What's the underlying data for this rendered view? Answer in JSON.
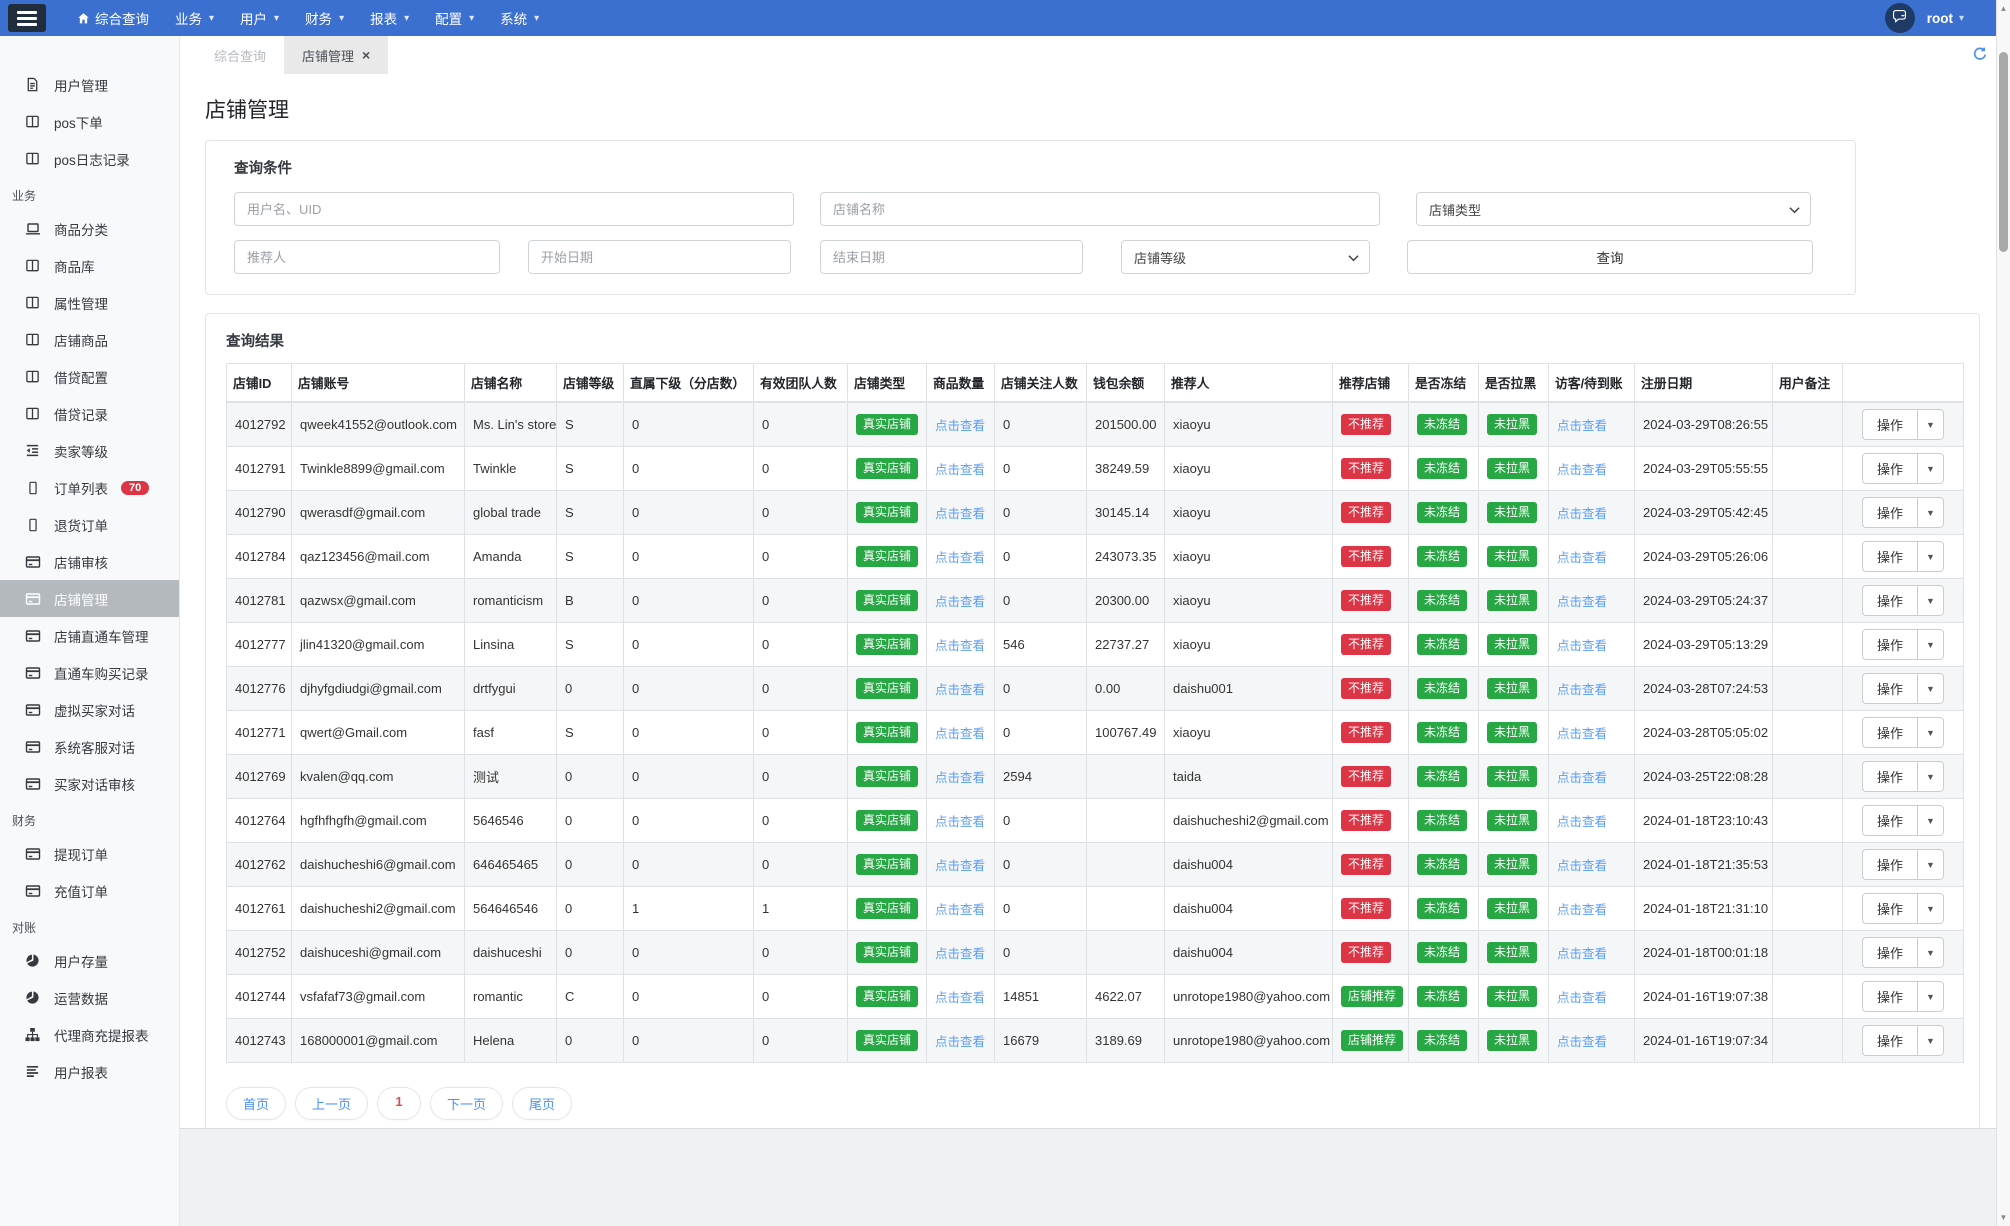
{
  "navbar": {
    "items": [
      {
        "key": "general-query",
        "label": "综合查询",
        "icon": "home",
        "caret": false
      },
      {
        "key": "business",
        "label": "业务",
        "caret": true
      },
      {
        "key": "user",
        "label": "用户",
        "caret": true
      },
      {
        "key": "finance",
        "label": "财务",
        "caret": true
      },
      {
        "key": "report",
        "label": "报表",
        "caret": true
      },
      {
        "key": "config",
        "label": "配置",
        "caret": true
      },
      {
        "key": "system",
        "label": "系统",
        "caret": true
      }
    ],
    "user": "root"
  },
  "sidebar": {
    "items": [
      {
        "key": "user-management",
        "label": "用户管理",
        "icon": "file"
      },
      {
        "key": "pos-order",
        "label": "pos下单",
        "icon": "table"
      },
      {
        "key": "pos-log",
        "label": "pos日志记录",
        "icon": "table"
      },
      {
        "section": "业务",
        "key": "section-business"
      },
      {
        "key": "goods-category",
        "label": "商品分类",
        "icon": "laptop"
      },
      {
        "key": "goods-library",
        "label": "商品库",
        "icon": "table"
      },
      {
        "key": "attribute-management",
        "label": "属性管理",
        "icon": "table"
      },
      {
        "key": "store-goods",
        "label": "店铺商品",
        "icon": "table"
      },
      {
        "key": "loan-config",
        "label": "借贷配置",
        "icon": "table"
      },
      {
        "key": "loan-record",
        "label": "借贷记录",
        "icon": "table"
      },
      {
        "key": "seller-level",
        "label": "卖家等级",
        "icon": "outdent"
      },
      {
        "key": "order-list",
        "label": "订单列表",
        "icon": "mobile",
        "badge": "70"
      },
      {
        "key": "return-order",
        "label": "退货订单",
        "icon": "mobile"
      },
      {
        "key": "store-audit",
        "label": "店铺审核",
        "icon": "card"
      },
      {
        "key": "store-management",
        "label": "店铺管理",
        "icon": "card",
        "active": true
      },
      {
        "key": "store-train-management",
        "label": "店铺直通车管理",
        "icon": "card"
      },
      {
        "key": "train-purchase-record",
        "label": "直通车购买记录",
        "icon": "card"
      },
      {
        "key": "virtual-buyer-chat",
        "label": "虚拟买家对话",
        "icon": "card"
      },
      {
        "key": "system-service-chat",
        "label": "系统客服对话",
        "icon": "card"
      },
      {
        "key": "buyer-chat-audit",
        "label": "买家对话审核",
        "icon": "card"
      },
      {
        "section": "财务",
        "key": "section-finance"
      },
      {
        "key": "withdraw-order",
        "label": "提现订单",
        "icon": "card"
      },
      {
        "key": "recharge-order",
        "label": "充值订单",
        "icon": "card"
      },
      {
        "section": "对账",
        "key": "section-reconciliation"
      },
      {
        "key": "user-stock",
        "label": "用户存量",
        "icon": "pie"
      },
      {
        "key": "operation-data",
        "label": "运营数据",
        "icon": "pie"
      },
      {
        "key": "agent-report",
        "label": "代理商充提报表",
        "icon": "sitemap"
      },
      {
        "key": "user-report",
        "label": "用户报表",
        "icon": "bars"
      }
    ]
  },
  "tabs": [
    {
      "key": "general-query",
      "label": "综合查询",
      "active": false,
      "closable": false
    },
    {
      "key": "store-management",
      "label": "店铺管理",
      "active": true,
      "closable": true
    }
  ],
  "page": {
    "title": "店铺管理"
  },
  "filter": {
    "title": "查询条件",
    "username_placeholder": "用户名、UID",
    "store_name_placeholder": "店铺名称",
    "store_type_placeholder": "店铺类型",
    "referrer_placeholder": "推荐人",
    "start_date_placeholder": "开始日期",
    "end_date_placeholder": "结束日期",
    "store_level_placeholder": "店铺等级",
    "submit_label": "查询"
  },
  "results": {
    "title": "查询结果",
    "columns": [
      "店铺ID",
      "店铺账号",
      "店铺名称",
      "店铺等级",
      "直属下级（分店数）",
      "有效团队人数",
      "店铺类型",
      "商品数量",
      "店铺关注人数",
      "钱包余额",
      "推荐人",
      "推荐店铺",
      "是否冻结",
      "是否拉黑",
      "访客/待到账",
      "注册日期",
      "用户备注",
      ""
    ],
    "store_type_label": "真实店铺",
    "view_link_label": "点击查看",
    "frozen_label": "未冻结",
    "blacklist_label": "未拉黑",
    "action_label": "操作",
    "rows": [
      {
        "id": "4012792",
        "account": "qweek41552@outlook.com",
        "name": "Ms. Lin's store",
        "level": "S",
        "direct_sub": "0",
        "team": "0",
        "followers": "0",
        "balance": "201500.00",
        "referrer": "xiaoyu",
        "recommend": "不推荐",
        "recommend_type": "danger",
        "registered": "2024-03-29T08:26:55",
        "remark": ""
      },
      {
        "id": "4012791",
        "account": "Twinkle8899@gmail.com",
        "name": "Twinkle",
        "level": "S",
        "direct_sub": "0",
        "team": "0",
        "followers": "0",
        "balance": "38249.59",
        "referrer": "xiaoyu",
        "recommend": "不推荐",
        "recommend_type": "danger",
        "registered": "2024-03-29T05:55:55",
        "remark": ""
      },
      {
        "id": "4012790",
        "account": "qwerasdf@gmail.com",
        "name": "global trade",
        "level": "S",
        "direct_sub": "0",
        "team": "0",
        "followers": "0",
        "balance": "30145.14",
        "referrer": "xiaoyu",
        "recommend": "不推荐",
        "recommend_type": "danger",
        "registered": "2024-03-29T05:42:45",
        "remark": ""
      },
      {
        "id": "4012784",
        "account": "qaz123456@mail.com",
        "name": "Amanda",
        "level": "S",
        "direct_sub": "0",
        "team": "0",
        "followers": "0",
        "balance": "243073.35",
        "referrer": "xiaoyu",
        "recommend": "不推荐",
        "recommend_type": "danger",
        "registered": "2024-03-29T05:26:06",
        "remark": ""
      },
      {
        "id": "4012781",
        "account": "qazwsx@gmail.com",
        "name": "romanticism",
        "level": "B",
        "direct_sub": "0",
        "team": "0",
        "followers": "0",
        "balance": "20300.00",
        "referrer": "xiaoyu",
        "recommend": "不推荐",
        "recommend_type": "danger",
        "registered": "2024-03-29T05:24:37",
        "remark": ""
      },
      {
        "id": "4012777",
        "account": "jlin41320@gmail.com",
        "name": "Linsina",
        "level": "S",
        "direct_sub": "0",
        "team": "0",
        "followers": "546",
        "balance": "22737.27",
        "referrer": "xiaoyu",
        "recommend": "不推荐",
        "recommend_type": "danger",
        "registered": "2024-03-29T05:13:29",
        "remark": ""
      },
      {
        "id": "4012776",
        "account": "djhyfgdiudgi@gmail.com",
        "name": "drtfygui",
        "level": "0",
        "direct_sub": "0",
        "team": "0",
        "followers": "0",
        "balance": "0.00",
        "referrer": "daishu001",
        "recommend": "不推荐",
        "recommend_type": "danger",
        "registered": "2024-03-28T07:24:53",
        "remark": ""
      },
      {
        "id": "4012771",
        "account": "qwert@Gmail.com",
        "name": "fasf",
        "level": "S",
        "direct_sub": "0",
        "team": "0",
        "followers": "0",
        "balance": "100767.49",
        "referrer": "xiaoyu",
        "recommend": "不推荐",
        "recommend_type": "danger",
        "registered": "2024-03-28T05:05:02",
        "remark": ""
      },
      {
        "id": "4012769",
        "account": "kvalen@qq.com",
        "name": "测试",
        "level": "0",
        "direct_sub": "0",
        "team": "0",
        "followers": "2594",
        "balance": "",
        "referrer": "taida",
        "recommend": "不推荐",
        "recommend_type": "danger",
        "registered": "2024-03-25T22:08:28",
        "remark": ""
      },
      {
        "id": "4012764",
        "account": "hgfhfhgfh@gmail.com",
        "name": "5646546",
        "level": "0",
        "direct_sub": "0",
        "team": "0",
        "followers": "0",
        "balance": "",
        "referrer": "daishucheshi2@gmail.com",
        "recommend": "不推荐",
        "recommend_type": "danger",
        "registered": "2024-01-18T23:10:43",
        "remark": ""
      },
      {
        "id": "4012762",
        "account": "daishucheshi6@gmail.com",
        "name": "646465465",
        "level": "0",
        "direct_sub": "0",
        "team": "0",
        "followers": "0",
        "balance": "",
        "referrer": "daishu004",
        "recommend": "不推荐",
        "recommend_type": "danger",
        "registered": "2024-01-18T21:35:53",
        "remark": ""
      },
      {
        "id": "4012761",
        "account": "daishucheshi2@gmail.com",
        "name": "564646546",
        "level": "0",
        "direct_sub": "1",
        "team": "1",
        "followers": "0",
        "balance": "",
        "referrer": "daishu004",
        "recommend": "不推荐",
        "recommend_type": "danger",
        "registered": "2024-01-18T21:31:10",
        "remark": ""
      },
      {
        "id": "4012752",
        "account": "daishuceshi@gmail.com",
        "name": "daishuceshi",
        "level": "0",
        "direct_sub": "0",
        "team": "0",
        "followers": "0",
        "balance": "",
        "referrer": "daishu004",
        "recommend": "不推荐",
        "recommend_type": "danger",
        "registered": "2024-01-18T00:01:18",
        "remark": ""
      },
      {
        "id": "4012744",
        "account": "vsfafaf73@gmail.com",
        "name": "romantic",
        "level": "C",
        "direct_sub": "0",
        "team": "0",
        "followers": "14851",
        "balance": "4622.07",
        "referrer": "unrotope1980@yahoo.com",
        "recommend": "店铺推荐",
        "recommend_type": "success",
        "registered": "2024-01-16T19:07:38",
        "remark": ""
      },
      {
        "id": "4012743",
        "account": "168000001@gmail.com",
        "name": "Helena",
        "level": "0",
        "direct_sub": "0",
        "team": "0",
        "followers": "16679",
        "balance": "3189.69",
        "referrer": "unrotope1980@yahoo.com",
        "recommend": "店铺推荐",
        "recommend_type": "success",
        "registered": "2024-01-16T19:07:34",
        "remark": ""
      }
    ],
    "pagination": [
      {
        "key": "first",
        "label": "首页",
        "current": false
      },
      {
        "key": "prev",
        "label": "上一页",
        "current": false
      },
      {
        "key": "page-1",
        "label": "1",
        "current": true
      },
      {
        "key": "next",
        "label": "下一页",
        "current": false
      },
      {
        "key": "last",
        "label": "尾页",
        "current": false
      }
    ]
  },
  "colors": {
    "navbar": "#3b70d1",
    "badge_success": "#28a745",
    "badge_danger": "#dc3545",
    "link_blue": "#5b9df6",
    "sidebar_active_bg": "#b4b9be",
    "pagination_current": "#d9534f"
  }
}
